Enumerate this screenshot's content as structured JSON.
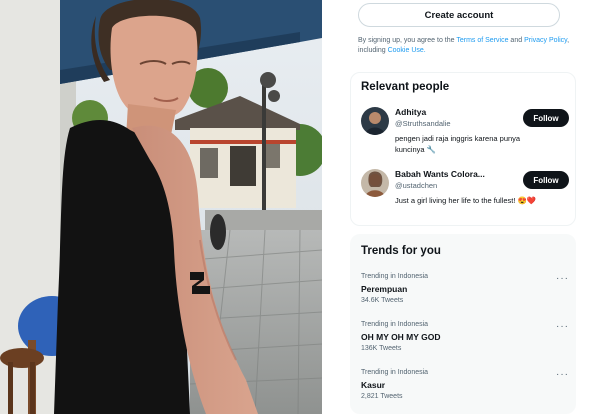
{
  "photo": {
    "description_icon": "photo"
  },
  "signup": {
    "create_account": "Create account",
    "legal_prefix": "By signing up, you agree to the",
    "terms": "Terms of Service",
    "and": "and",
    "privacy": "Privacy Policy",
    "including": ", including",
    "cookie": "Cookie Use."
  },
  "relevant": {
    "title": "Relevant people",
    "people": [
      {
        "name": "Adhitya",
        "handle": "@Struthsandalie",
        "bio": "pengen jadi raja inggris karena punya kuncinya 🔧",
        "follow": "Follow"
      },
      {
        "name": "Babah Wants Colora...",
        "handle": "@ustadchen",
        "bio": "Just a girl living her life to the fullest! 😍❤️",
        "follow": "Follow"
      }
    ]
  },
  "trends": {
    "title": "Trends for you",
    "items": [
      {
        "context": "Trending in Indonesia",
        "name": "Perempuan",
        "count": "34.6K Tweets",
        "more": "···"
      },
      {
        "context": "Trending in Indonesia",
        "name": "OH MY OH MY GOD",
        "count": "136K Tweets",
        "more": "···"
      },
      {
        "context": "Trending in Indonesia",
        "name": "Kasur",
        "count": "2,821 Tweets",
        "more": "···"
      }
    ]
  },
  "colors": {
    "accent": "#1d9bf0",
    "text": "#0f1419",
    "muted": "#536471",
    "button_dark": "#0f1419"
  }
}
